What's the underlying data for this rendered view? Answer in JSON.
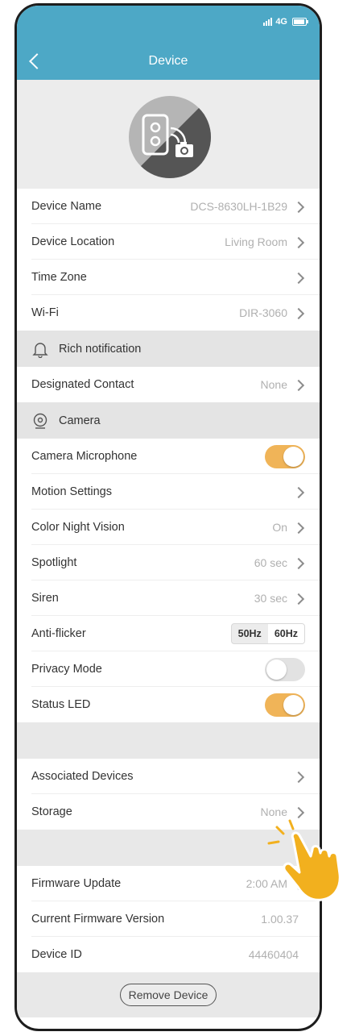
{
  "status_bar": {
    "network": "4G"
  },
  "header": {
    "title": "Device",
    "back_icon": "chevron-left-icon"
  },
  "device_settings": [
    {
      "label": "Device Name",
      "value": "DCS-8630LH-1B29"
    },
    {
      "label": "Device Location",
      "value": "Living Room"
    },
    {
      "label": "Time Zone",
      "value": ""
    },
    {
      "label": "Wi-Fi",
      "value": "DIR-3060"
    }
  ],
  "rich_notification": {
    "section_label": "Rich notification",
    "icon": "bell-icon",
    "designated_contact": {
      "label": "Designated Contact",
      "value": "None"
    }
  },
  "camera": {
    "section_label": "Camera",
    "icon": "camera-icon",
    "microphone": {
      "label": "Camera Microphone",
      "on": true
    },
    "motion": {
      "label": "Motion Settings",
      "value": ""
    },
    "night_vision": {
      "label": "Color Night Vision",
      "value": "On"
    },
    "spotlight": {
      "label": "Spotlight",
      "value": "60 sec"
    },
    "siren": {
      "label": "Siren",
      "value": "30 sec"
    },
    "anti_flicker": {
      "label": "Anti-flicker",
      "options": [
        "50Hz",
        "60Hz"
      ],
      "selected": "60Hz"
    },
    "privacy": {
      "label": "Privacy Mode",
      "on": false
    },
    "status_led": {
      "label": "Status LED",
      "on": true
    }
  },
  "other": {
    "associated": {
      "label": "Associated Devices"
    },
    "storage": {
      "label": "Storage",
      "value": "None"
    }
  },
  "firmware": {
    "update": {
      "label": "Firmware Update",
      "value": "2:00 AM"
    },
    "version": {
      "label": "Current Firmware Version",
      "value": "1.00.37"
    },
    "device_id": {
      "label": "Device ID",
      "value": "44460404"
    }
  },
  "remove_button": "Remove Device",
  "colors": {
    "header": "#4da8c6",
    "toggle_on": "#f0b458",
    "hand": "#f2b01e"
  }
}
